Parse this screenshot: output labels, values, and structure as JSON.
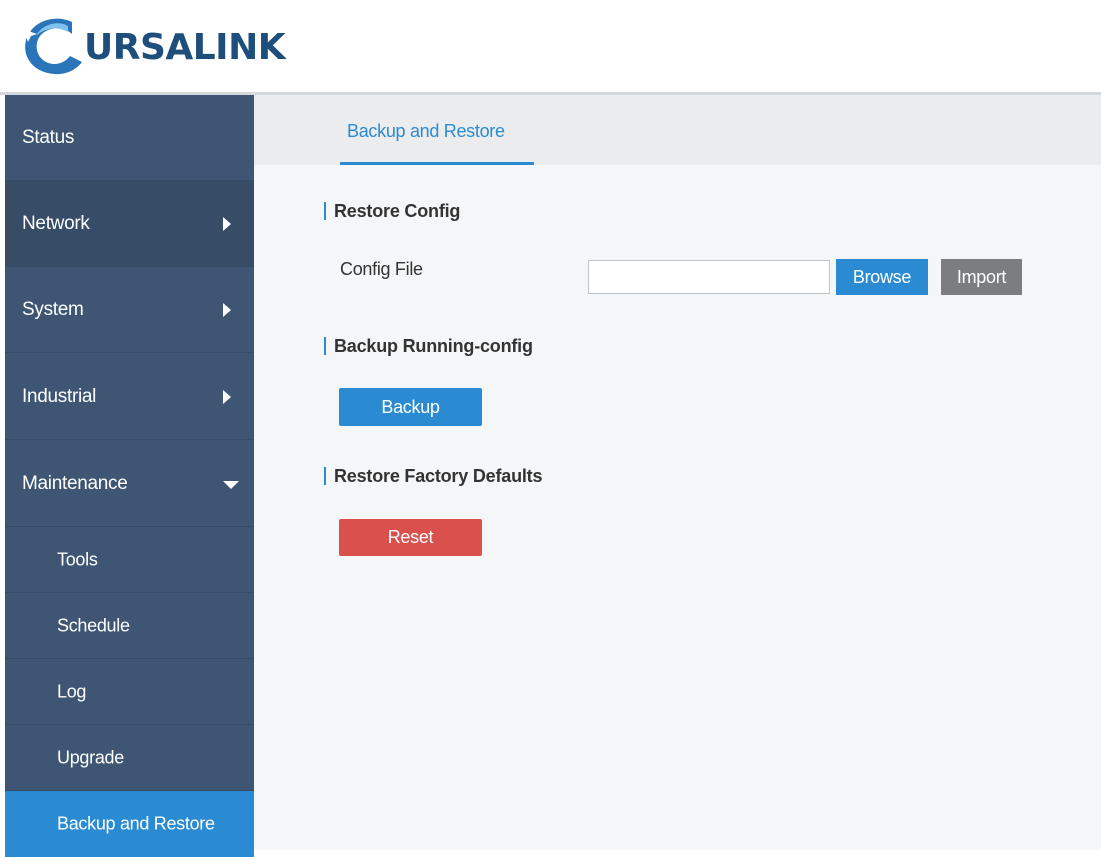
{
  "brand": {
    "logo_text": "URSALINK",
    "colors": {
      "logo_dark": "#1d4e7c",
      "logo_light": "#3a8fd6"
    }
  },
  "colors": {
    "sidebar_bg": "#3e5673",
    "active_blue": "#2a8bd2",
    "reset_red": "#d9504c",
    "import_gray": "#7b7d80",
    "content_bg": "#f5f6f7"
  },
  "sidebar": {
    "items": [
      {
        "label": "Status",
        "icon": null
      },
      {
        "label": "Network",
        "icon": "arrow-right-icon"
      },
      {
        "label": "System",
        "icon": "arrow-right-icon"
      },
      {
        "label": "Industrial",
        "icon": "arrow-right-icon"
      },
      {
        "label": "Maintenance",
        "icon": "arrow-down-icon",
        "expanded": true
      }
    ],
    "sub_items": [
      {
        "label": "Tools"
      },
      {
        "label": "Schedule"
      },
      {
        "label": "Log"
      },
      {
        "label": "Upgrade"
      },
      {
        "label": "Backup and Restore",
        "active": true
      }
    ]
  },
  "main": {
    "tabs": [
      {
        "label": "Backup and Restore",
        "active": true
      }
    ],
    "restore_config": {
      "title": "Restore Config",
      "config_file_label": "Config File",
      "config_file_value": "",
      "browse_label": "Browse",
      "import_label": "Import"
    },
    "backup": {
      "title": "Backup Running-config",
      "button_label": "Backup"
    },
    "factory": {
      "title": "Restore Factory Defaults",
      "button_label": "Reset"
    }
  }
}
